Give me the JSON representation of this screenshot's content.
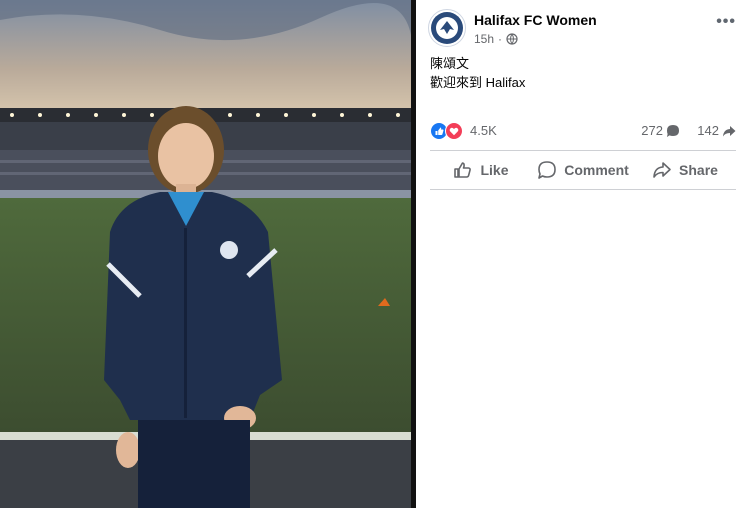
{
  "post": {
    "page_name": "Halifax FC Women",
    "time": "15h",
    "text_line1": "陳頌文",
    "text_line2": "歡迎來到 Halifax",
    "reactions_count": "4.5K",
    "comments_count": "272",
    "shares_count": "142"
  },
  "actions": {
    "like": "Like",
    "comment": "Comment",
    "share": "Share"
  },
  "icons": {
    "privacy": "globe-icon",
    "more": "more-options-icon",
    "reaction_like": "like-reaction-icon",
    "reaction_love": "love-reaction-icon"
  },
  "colors": {
    "like_blue": "#1877f2",
    "love_red": "#f33e58",
    "text_secondary": "#65676b",
    "jacket_navy": "#1f2f4d"
  }
}
